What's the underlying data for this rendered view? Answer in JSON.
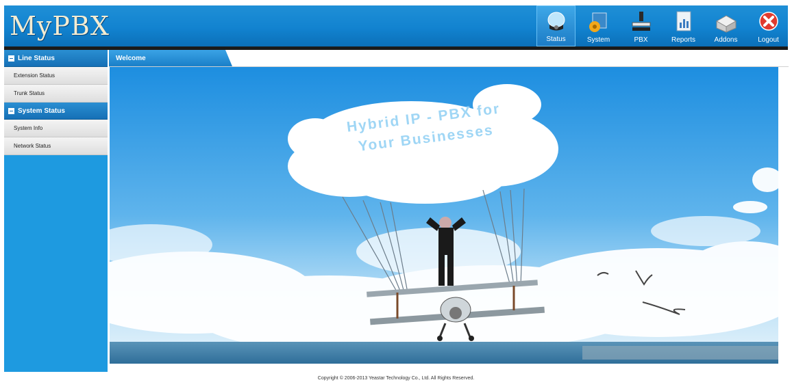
{
  "app": {
    "logo_text": "MyPBX"
  },
  "nav": [
    {
      "label": "Status",
      "icon": "status-icon",
      "active": true
    },
    {
      "label": "System",
      "icon": "system-icon",
      "active": false
    },
    {
      "label": "PBX",
      "icon": "pbx-icon",
      "active": false
    },
    {
      "label": "Reports",
      "icon": "reports-icon",
      "active": false
    },
    {
      "label": "Addons",
      "icon": "addons-icon",
      "active": false
    },
    {
      "label": "Logout",
      "icon": "logout-icon",
      "active": false
    }
  ],
  "sidebar": {
    "sections": [
      {
        "title": "Line Status",
        "items": [
          "Extension Status",
          "Trunk Status"
        ]
      },
      {
        "title": "System Status",
        "items": [
          "System Info",
          "Network Status"
        ]
      }
    ]
  },
  "content": {
    "tab": "Welcome",
    "banner_text_1": "Hybrid IP - PBX for",
    "banner_text_2": "Your Businesses"
  },
  "footer": {
    "copyright": "Copyright © 2006-2013 Yeastar Technology Co., Ltd. All Rights Reserved."
  },
  "colors": {
    "header_blue": "#1283d0",
    "sidebar_blue": "#1e9ae0",
    "logout_red": "#e03a2e"
  }
}
